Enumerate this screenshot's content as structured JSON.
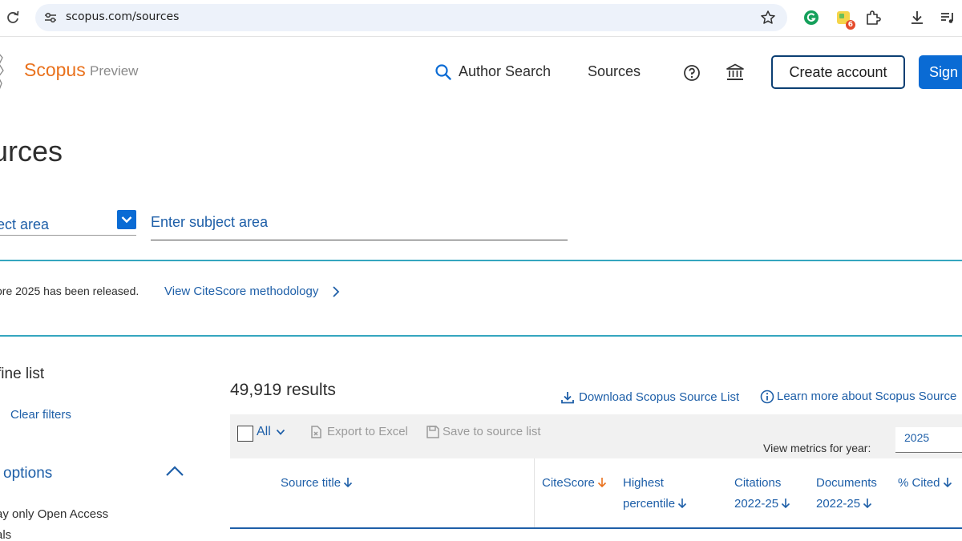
{
  "browser": {
    "url": "scopus.com/sources",
    "ext_badge": "6"
  },
  "header": {
    "brand": "Scopus",
    "brand_suffix": "Preview",
    "nav": [
      "Author Search",
      "Sources"
    ],
    "create_account": "Create account",
    "sign_in": "Sign"
  },
  "page": {
    "title": "urces"
  },
  "search": {
    "subject_label": "ject area",
    "subject_placeholder": "Enter subject area"
  },
  "notice": {
    "text": "ore 2025 has been released.",
    "link": "View CiteScore methodology"
  },
  "filters": {
    "refine": "fine list",
    "clear": "Clear filters",
    "options": "options",
    "open_access_line1": "ay only Open Access",
    "open_access_line2": "als"
  },
  "results": {
    "count": "49,919 results",
    "download_link": "Download Scopus Source List",
    "learn_link": "Learn more about Scopus Source"
  },
  "toolbar": {
    "all": "All",
    "export": "Export to Excel",
    "save": "Save to source list",
    "metric_label": "View metrics for year:",
    "year": "2025"
  },
  "columns": {
    "source_title": "Source title",
    "citescore": "CiteScore",
    "highest_1": "Highest",
    "highest_2": "percentile",
    "citations_1": "Citations",
    "citations_2": "2022-25",
    "documents_1": "Documents",
    "documents_2": "2022-25",
    "cited": "% Cited"
  },
  "colors": {
    "brand_orange": "#e9711c",
    "link_blue": "#1e5fa8",
    "primary_button": "#0a6bd4",
    "teal_rule": "#35a6bf"
  }
}
